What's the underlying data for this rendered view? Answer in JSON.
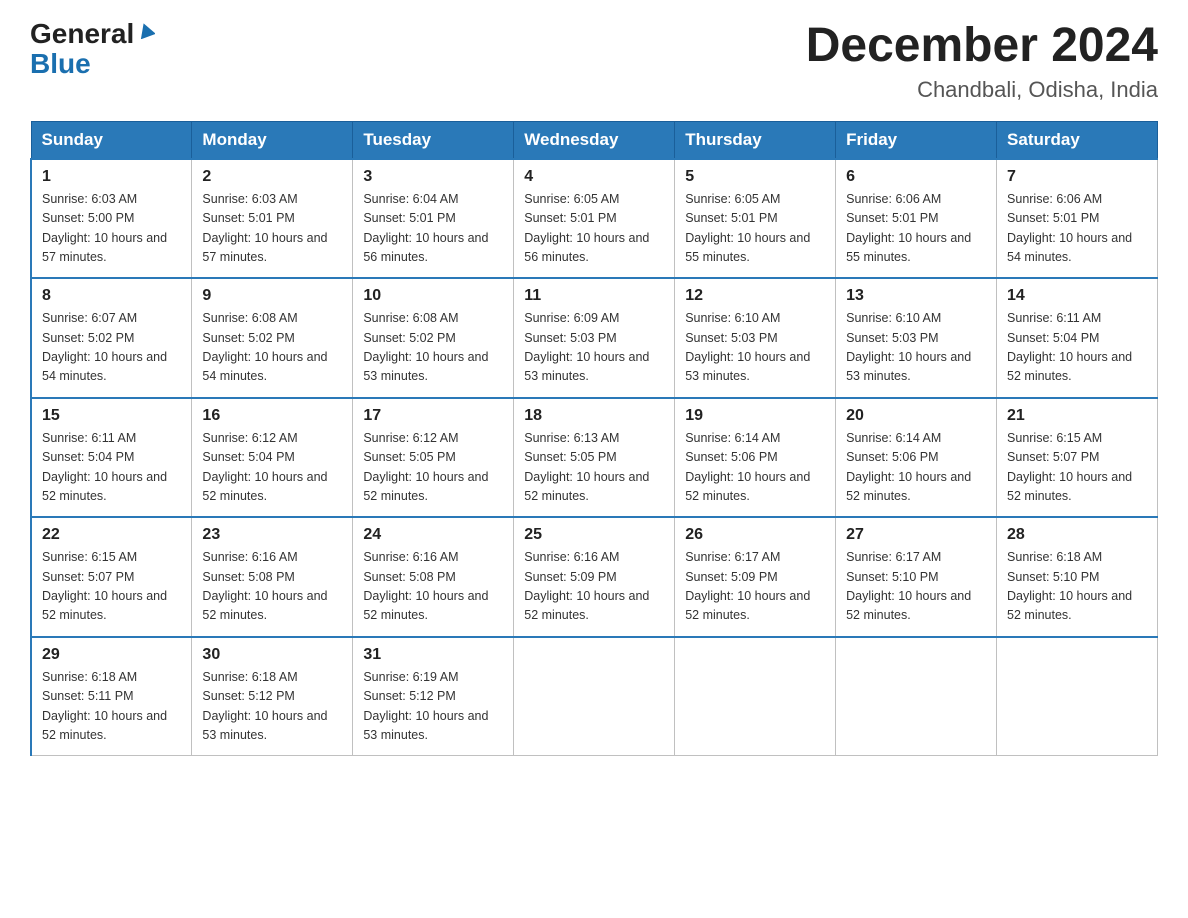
{
  "header": {
    "logo_general": "General",
    "logo_blue": "Blue",
    "title": "December 2024",
    "subtitle": "Chandbali, Odisha, India"
  },
  "days_of_week": [
    "Sunday",
    "Monday",
    "Tuesday",
    "Wednesday",
    "Thursday",
    "Friday",
    "Saturday"
  ],
  "weeks": [
    [
      {
        "day": "1",
        "sunrise": "Sunrise: 6:03 AM",
        "sunset": "Sunset: 5:00 PM",
        "daylight": "Daylight: 10 hours and 57 minutes."
      },
      {
        "day": "2",
        "sunrise": "Sunrise: 6:03 AM",
        "sunset": "Sunset: 5:01 PM",
        "daylight": "Daylight: 10 hours and 57 minutes."
      },
      {
        "day": "3",
        "sunrise": "Sunrise: 6:04 AM",
        "sunset": "Sunset: 5:01 PM",
        "daylight": "Daylight: 10 hours and 56 minutes."
      },
      {
        "day": "4",
        "sunrise": "Sunrise: 6:05 AM",
        "sunset": "Sunset: 5:01 PM",
        "daylight": "Daylight: 10 hours and 56 minutes."
      },
      {
        "day": "5",
        "sunrise": "Sunrise: 6:05 AM",
        "sunset": "Sunset: 5:01 PM",
        "daylight": "Daylight: 10 hours and 55 minutes."
      },
      {
        "day": "6",
        "sunrise": "Sunrise: 6:06 AM",
        "sunset": "Sunset: 5:01 PM",
        "daylight": "Daylight: 10 hours and 55 minutes."
      },
      {
        "day": "7",
        "sunrise": "Sunrise: 6:06 AM",
        "sunset": "Sunset: 5:01 PM",
        "daylight": "Daylight: 10 hours and 54 minutes."
      }
    ],
    [
      {
        "day": "8",
        "sunrise": "Sunrise: 6:07 AM",
        "sunset": "Sunset: 5:02 PM",
        "daylight": "Daylight: 10 hours and 54 minutes."
      },
      {
        "day": "9",
        "sunrise": "Sunrise: 6:08 AM",
        "sunset": "Sunset: 5:02 PM",
        "daylight": "Daylight: 10 hours and 54 minutes."
      },
      {
        "day": "10",
        "sunrise": "Sunrise: 6:08 AM",
        "sunset": "Sunset: 5:02 PM",
        "daylight": "Daylight: 10 hours and 53 minutes."
      },
      {
        "day": "11",
        "sunrise": "Sunrise: 6:09 AM",
        "sunset": "Sunset: 5:03 PM",
        "daylight": "Daylight: 10 hours and 53 minutes."
      },
      {
        "day": "12",
        "sunrise": "Sunrise: 6:10 AM",
        "sunset": "Sunset: 5:03 PM",
        "daylight": "Daylight: 10 hours and 53 minutes."
      },
      {
        "day": "13",
        "sunrise": "Sunrise: 6:10 AM",
        "sunset": "Sunset: 5:03 PM",
        "daylight": "Daylight: 10 hours and 53 minutes."
      },
      {
        "day": "14",
        "sunrise": "Sunrise: 6:11 AM",
        "sunset": "Sunset: 5:04 PM",
        "daylight": "Daylight: 10 hours and 52 minutes."
      }
    ],
    [
      {
        "day": "15",
        "sunrise": "Sunrise: 6:11 AM",
        "sunset": "Sunset: 5:04 PM",
        "daylight": "Daylight: 10 hours and 52 minutes."
      },
      {
        "day": "16",
        "sunrise": "Sunrise: 6:12 AM",
        "sunset": "Sunset: 5:04 PM",
        "daylight": "Daylight: 10 hours and 52 minutes."
      },
      {
        "day": "17",
        "sunrise": "Sunrise: 6:12 AM",
        "sunset": "Sunset: 5:05 PM",
        "daylight": "Daylight: 10 hours and 52 minutes."
      },
      {
        "day": "18",
        "sunrise": "Sunrise: 6:13 AM",
        "sunset": "Sunset: 5:05 PM",
        "daylight": "Daylight: 10 hours and 52 minutes."
      },
      {
        "day": "19",
        "sunrise": "Sunrise: 6:14 AM",
        "sunset": "Sunset: 5:06 PM",
        "daylight": "Daylight: 10 hours and 52 minutes."
      },
      {
        "day": "20",
        "sunrise": "Sunrise: 6:14 AM",
        "sunset": "Sunset: 5:06 PM",
        "daylight": "Daylight: 10 hours and 52 minutes."
      },
      {
        "day": "21",
        "sunrise": "Sunrise: 6:15 AM",
        "sunset": "Sunset: 5:07 PM",
        "daylight": "Daylight: 10 hours and 52 minutes."
      }
    ],
    [
      {
        "day": "22",
        "sunrise": "Sunrise: 6:15 AM",
        "sunset": "Sunset: 5:07 PM",
        "daylight": "Daylight: 10 hours and 52 minutes."
      },
      {
        "day": "23",
        "sunrise": "Sunrise: 6:16 AM",
        "sunset": "Sunset: 5:08 PM",
        "daylight": "Daylight: 10 hours and 52 minutes."
      },
      {
        "day": "24",
        "sunrise": "Sunrise: 6:16 AM",
        "sunset": "Sunset: 5:08 PM",
        "daylight": "Daylight: 10 hours and 52 minutes."
      },
      {
        "day": "25",
        "sunrise": "Sunrise: 6:16 AM",
        "sunset": "Sunset: 5:09 PM",
        "daylight": "Daylight: 10 hours and 52 minutes."
      },
      {
        "day": "26",
        "sunrise": "Sunrise: 6:17 AM",
        "sunset": "Sunset: 5:09 PM",
        "daylight": "Daylight: 10 hours and 52 minutes."
      },
      {
        "day": "27",
        "sunrise": "Sunrise: 6:17 AM",
        "sunset": "Sunset: 5:10 PM",
        "daylight": "Daylight: 10 hours and 52 minutes."
      },
      {
        "day": "28",
        "sunrise": "Sunrise: 6:18 AM",
        "sunset": "Sunset: 5:10 PM",
        "daylight": "Daylight: 10 hours and 52 minutes."
      }
    ],
    [
      {
        "day": "29",
        "sunrise": "Sunrise: 6:18 AM",
        "sunset": "Sunset: 5:11 PM",
        "daylight": "Daylight: 10 hours and 52 minutes."
      },
      {
        "day": "30",
        "sunrise": "Sunrise: 6:18 AM",
        "sunset": "Sunset: 5:12 PM",
        "daylight": "Daylight: 10 hours and 53 minutes."
      },
      {
        "day": "31",
        "sunrise": "Sunrise: 6:19 AM",
        "sunset": "Sunset: 5:12 PM",
        "daylight": "Daylight: 10 hours and 53 minutes."
      },
      null,
      null,
      null,
      null
    ]
  ]
}
